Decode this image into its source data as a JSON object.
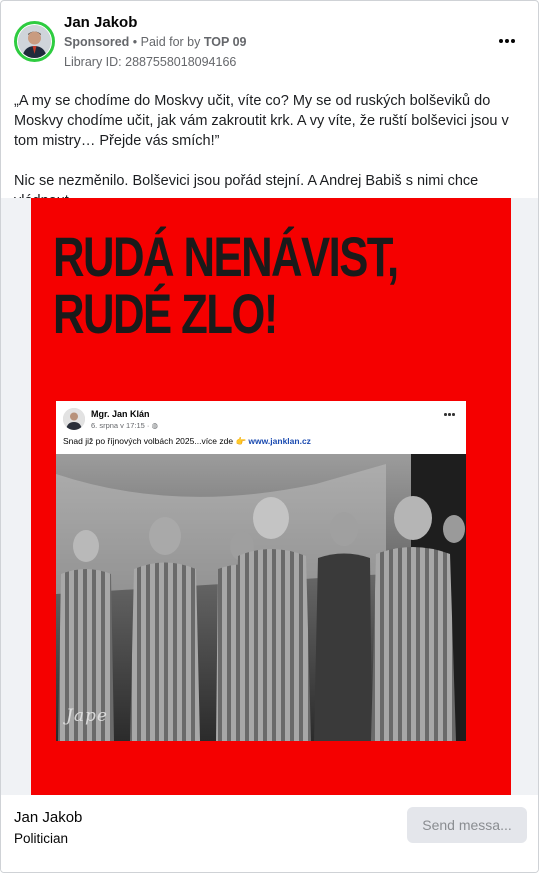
{
  "post": {
    "author": "Jan Jakob",
    "sponsored_label": "Sponsored",
    "bullet": " • ",
    "paid_prefix": "Paid for by ",
    "paid_by": "TOP 09",
    "library_id": "Library ID: 2887558018094166",
    "text_paragraph_1": "„A my se chodíme do Moskvy učit, víte co? My se od ruských bolševiků do Moskvy chodíme učit, jak vám zakroutit krk. A vy víte, že ruští bolševici jsou v tom mistry… Přejde vás smích!”",
    "text_paragraph_2": "Nic se nezměnilo. Bolševici jsou pořád stejní. A Andrej Babiš s nimi chce vládnout."
  },
  "poster": {
    "headline_line_1": "RUDÁ NENÁVIST,",
    "headline_line_2": "RUDÉ ZLO!",
    "background_color": "#f50000",
    "embedded_post": {
      "name": "Mgr. Jan Klán",
      "date": "6. srpna v 17:15 · ",
      "text": "Snad již po říjnových volbách 2025...více zde 👉 ",
      "link": "www.janklan.cz",
      "signature": "Jape"
    }
  },
  "footer": {
    "name": "Jan Jakob",
    "role": "Politician",
    "send_button": "Send messa..."
  },
  "colors": {
    "avatar_ring": "#2ecc40",
    "link": "#1a4ab0"
  }
}
